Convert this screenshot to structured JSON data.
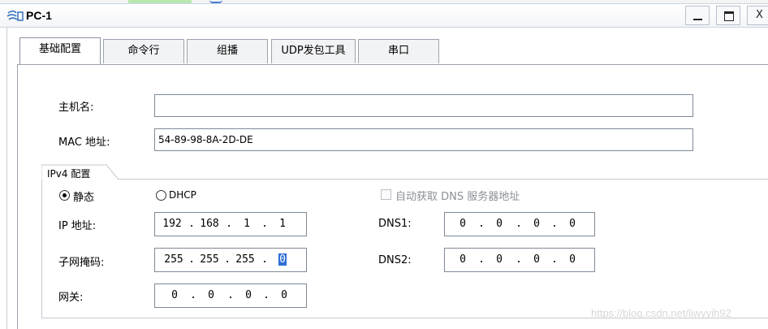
{
  "window": {
    "title": "PC-1",
    "minimize_label": "_",
    "close_label": "X"
  },
  "tabs": [
    {
      "label": "基础配置",
      "active": true
    },
    {
      "label": "命令行",
      "active": false
    },
    {
      "label": "组播",
      "active": false
    },
    {
      "label": "UDP发包工具",
      "active": false
    },
    {
      "label": "串口",
      "active": false
    }
  ],
  "basic": {
    "hostname_label": "主机名:",
    "hostname_value": "",
    "mac_label": "MAC 地址:",
    "mac_value": "54-89-98-8A-2D-DE"
  },
  "ipv4": {
    "group_title": "IPv4 配置",
    "static_label": "静态",
    "dhcp_label": "DHCP",
    "mode": "static",
    "auto_dns_label": "自动获取 DNS 服务器地址",
    "auto_dns_checked": false,
    "ip_label": "IP 地址:",
    "ip": [
      "192",
      "168",
      "1",
      "1"
    ],
    "mask_label": "子网掩码:",
    "mask": [
      "255",
      "255",
      "255",
      "0"
    ],
    "gateway_label": "网关:",
    "gateway": [
      "0",
      "0",
      "0",
      "0"
    ],
    "dns1_label": "DNS1:",
    "dns1": [
      "0",
      "0",
      "0",
      "0"
    ],
    "dns2_label": "DNS2:",
    "dns2": [
      "0",
      "0",
      "0",
      "0"
    ]
  },
  "watermark": "https://blog.csdn.net/liwyyih92",
  "colors": {
    "selection": "#2f6fd6",
    "border": "#7f8a96"
  }
}
